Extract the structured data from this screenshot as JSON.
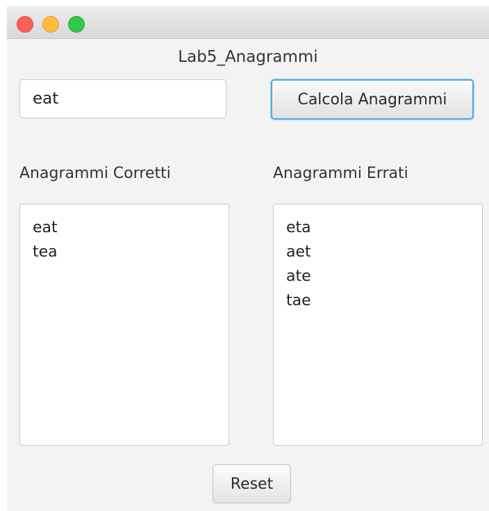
{
  "window": {
    "title": "Lab5_Anagrammi"
  },
  "input": {
    "value": "eat"
  },
  "buttons": {
    "calculate_label": "Calcola Anagrammi",
    "reset_label": "Reset"
  },
  "correct": {
    "label": "Anagrammi Corretti",
    "items": [
      "eat",
      "tea"
    ]
  },
  "wrong": {
    "label": "Anagrammi Errati",
    "items": [
      "eta",
      "aet",
      "ate",
      "tae"
    ]
  },
  "colors": {
    "close": "#fc605b",
    "minimize": "#fdbc40",
    "maximize": "#34c84a",
    "focus_ring": "#56a8e0"
  }
}
